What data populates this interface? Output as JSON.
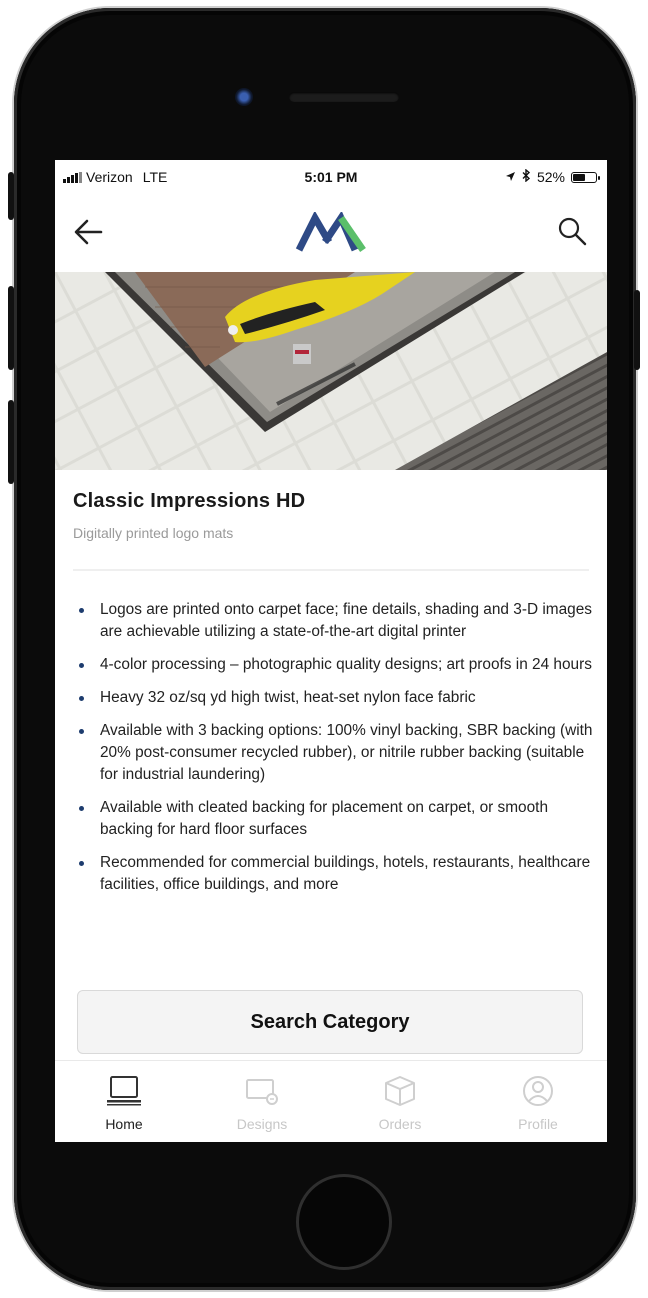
{
  "status_bar": {
    "carrier": "Verizon",
    "network": "LTE",
    "time": "5:01 PM",
    "battery": "52%",
    "battery_level": 0.52
  },
  "nav": {
    "back_icon": "arrow-left-icon",
    "logo_icon": "brand-logo",
    "search_icon": "search-icon"
  },
  "product": {
    "title": "Classic Impressions HD",
    "subtitle": "Digitally printed logo mats",
    "features": [
      "Logos are printed onto carpet face; fine details, shading and 3-D images are achievable utilizing a state-of-the-art digital printer",
      "4-color processing – photographic quality designs; art proofs in 24 hours",
      "Heavy 32 oz/sq yd high twist, heat-set nylon face fabric",
      "Available with 3 backing options: 100% vinyl backing, SBR backing (with 20% post-consumer recycled rubber), or nitrile rubber backing (suitable for industrial laundering)",
      "Available with cleated backing for placement on carpet, or smooth backing for hard floor surfaces",
      "Recommended for commercial buildings, hotels, restaurants, healthcare facilities, office buildings, and more"
    ]
  },
  "cta": {
    "label": "Search Category"
  },
  "tabs": [
    {
      "label": "Home",
      "icon": "laptop-icon",
      "active": true
    },
    {
      "label": "Designs",
      "icon": "designs-icon",
      "active": false
    },
    {
      "label": "Orders",
      "icon": "box-icon",
      "active": false
    },
    {
      "label": "Profile",
      "icon": "user-icon",
      "active": false
    }
  ],
  "colors": {
    "logo_blue": "#2e4a86",
    "logo_green": "#5bbf6a",
    "bullet": "#1d3c6e"
  }
}
